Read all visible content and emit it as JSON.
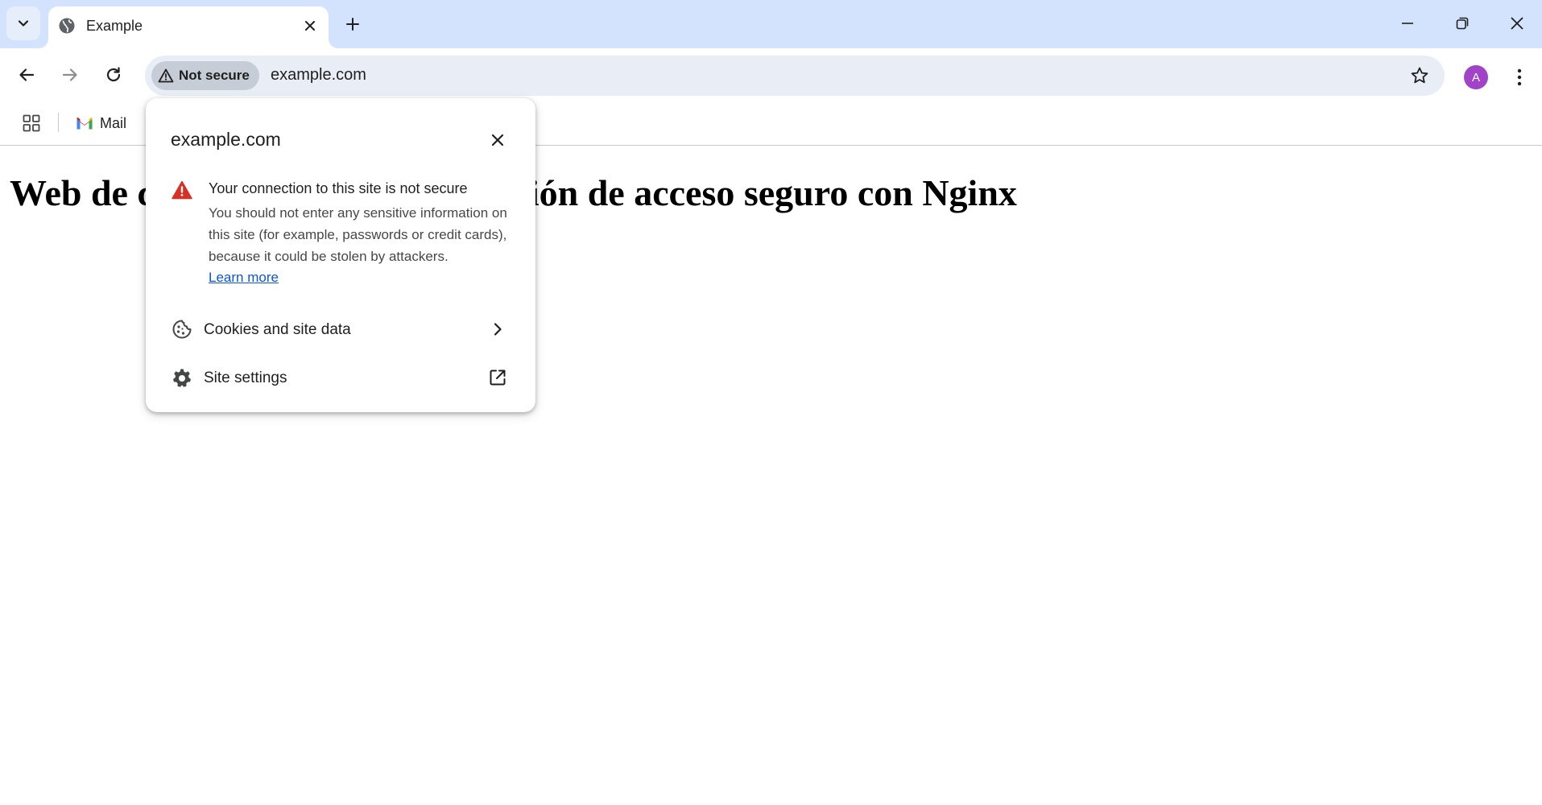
{
  "browser": {
    "tab": {
      "title": "Example"
    },
    "address_bar": {
      "security_chip_label": "Not secure",
      "url": "example.com"
    },
    "profile_initial": "A",
    "accent_color": "#a142c9"
  },
  "bookmarks": {
    "items": [
      {
        "label": "Mail",
        "icon": "gmail-icon"
      }
    ]
  },
  "page": {
    "heading": "Web de comprobar la configuración de acceso seguro con Nginx"
  },
  "site_info_popup": {
    "title": "example.com",
    "warning_heading": "Your connection to this site is not secure",
    "warning_body": "You should not enter any sensitive information on this site (for example, passwords or credit cards), because it could be stolen by attackers.",
    "learn_more": "Learn more",
    "rows": [
      {
        "label": "Cookies and site data",
        "icon": "cookie-icon",
        "trail": "chevron-right-icon"
      },
      {
        "label": "Site settings",
        "icon": "gear-icon",
        "trail": "open-in-new-icon"
      }
    ],
    "warning_color": "#d93025"
  }
}
